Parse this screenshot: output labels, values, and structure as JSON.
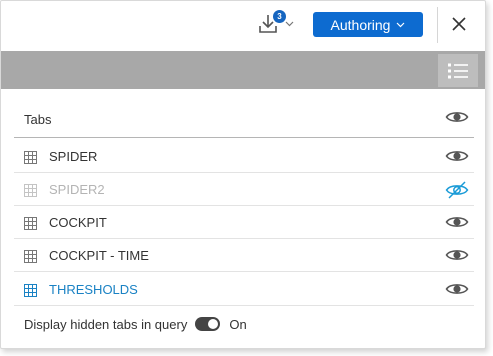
{
  "toolbar": {
    "download_badge": "3",
    "authoring_label": "Authoring"
  },
  "tabs": {
    "title": "Tabs",
    "items": [
      {
        "label": "SPIDER",
        "state": "visible"
      },
      {
        "label": "SPIDER2",
        "state": "hidden"
      },
      {
        "label": "COCKPIT",
        "state": "visible"
      },
      {
        "label": "COCKPIT - TIME",
        "state": "visible"
      },
      {
        "label": "THRESHOLDS",
        "state": "active"
      }
    ]
  },
  "footer": {
    "label": "Display hidden tabs in query",
    "toggle_state": "On"
  },
  "colors": {
    "accent": "#0d6bd0",
    "active_tab": "#1a82c4",
    "hidden_eye": "#1a9bd7",
    "band": "#a8a8a8"
  },
  "icons": [
    "download-icon",
    "chevron-down-icon",
    "close-icon",
    "list-view-icon",
    "eye-icon",
    "eye-slash-icon",
    "table-icon"
  ]
}
